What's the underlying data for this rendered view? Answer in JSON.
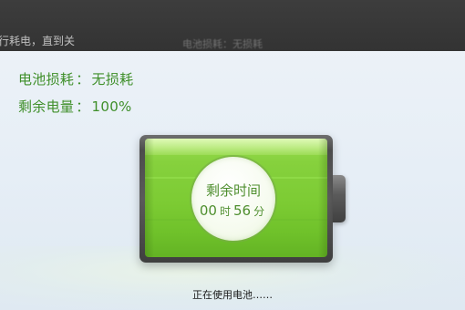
{
  "background_window": {
    "left_text": "行耗电，直到关",
    "mid_text": "电池损耗：无损耗"
  },
  "battery_info": {
    "loss_label": "电池损耗",
    "loss_value": "无损耗",
    "charge_label": "剩余电量",
    "charge_value": "100%",
    "separator": "："
  },
  "battery": {
    "level": 1.0,
    "color": "#7ccb33"
  },
  "remaining_time": {
    "label": "剩余时间",
    "hours": "00",
    "hours_unit": "时",
    "minutes": "56",
    "minutes_unit": "分"
  },
  "status": {
    "text": "正在使用电池……"
  }
}
